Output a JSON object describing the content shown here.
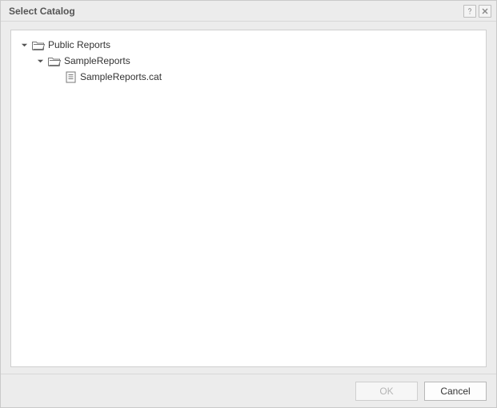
{
  "dialog": {
    "title": "Select Catalog"
  },
  "tree": {
    "root": {
      "label": "Public Reports",
      "child": {
        "label": "SampleReports",
        "file": {
          "label": "SampleReports.cat"
        }
      }
    }
  },
  "buttons": {
    "ok": "OK",
    "cancel": "Cancel"
  }
}
